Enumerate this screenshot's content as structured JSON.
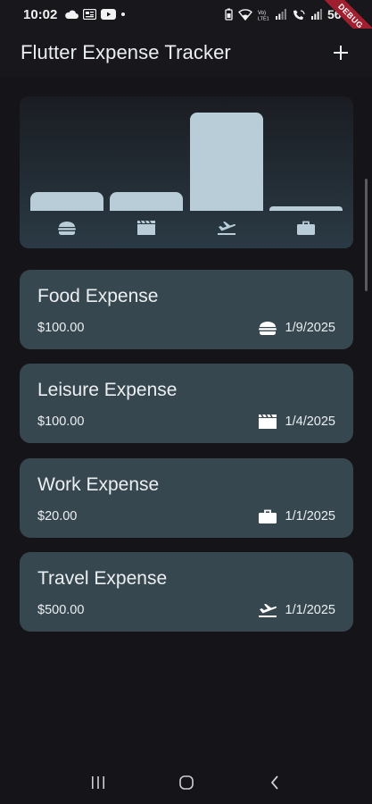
{
  "status_bar": {
    "time": "10:02",
    "battery": "56%"
  },
  "debug_banner": "DEBUG",
  "app_bar": {
    "title": "Flutter Expense Tracker",
    "add_icon": "+"
  },
  "chart": {
    "colors": {
      "bar": "#b8cdd8",
      "icon": "#b8cdd8"
    },
    "buckets": [
      {
        "category": "food",
        "icon": "burger-icon",
        "fill": 0.18
      },
      {
        "category": "leisure",
        "icon": "movie-icon",
        "fill": 0.18
      },
      {
        "category": "travel",
        "icon": "flight-takeoff-icon",
        "fill": 0.93
      },
      {
        "category": "work",
        "icon": "briefcase-icon",
        "fill": 0.04
      }
    ]
  },
  "expenses": [
    {
      "title": "Food Expense",
      "amount": "$100.00",
      "icon": "burger-icon",
      "date": "1/9/2025"
    },
    {
      "title": "Leisure Expense",
      "amount": "$100.00",
      "icon": "movie-icon",
      "date": "1/4/2025"
    },
    {
      "title": "Work Expense",
      "amount": "$20.00",
      "icon": "briefcase-icon",
      "date": "1/1/2025"
    },
    {
      "title": "Travel Expense",
      "amount": "$500.00",
      "icon": "flight-takeoff-icon",
      "date": "1/1/2025"
    }
  ],
  "theme": {
    "background": "#141419",
    "card": "#37474f",
    "text": "#eceff1"
  }
}
